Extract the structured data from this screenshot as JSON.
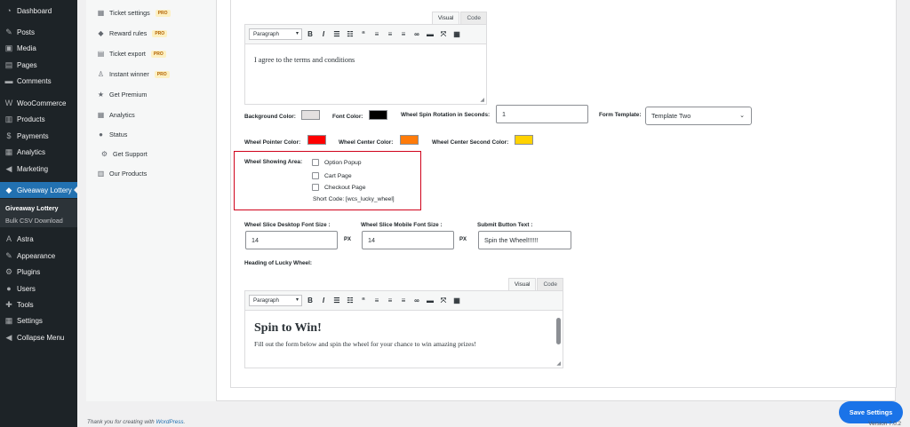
{
  "sidebar": {
    "items": [
      {
        "label": "Dashboard",
        "icon": "dashboard-icon",
        "glyph": "◔"
      },
      {
        "label": "Posts",
        "icon": "pin-icon",
        "glyph": "✎"
      },
      {
        "label": "Media",
        "icon": "media-icon",
        "glyph": "▣"
      },
      {
        "label": "Pages",
        "icon": "pages-icon",
        "glyph": "▤"
      },
      {
        "label": "Comments",
        "icon": "comments-icon",
        "glyph": "▬"
      },
      {
        "label": "WooCommerce",
        "icon": "woocommerce-icon",
        "glyph": "W"
      },
      {
        "label": "Products",
        "icon": "products-icon",
        "glyph": "▥"
      },
      {
        "label": "Payments",
        "icon": "payments-icon",
        "glyph": "$"
      },
      {
        "label": "Analytics",
        "icon": "analytics-icon",
        "glyph": "▦"
      },
      {
        "label": "Marketing",
        "icon": "marketing-icon",
        "glyph": "◀"
      },
      {
        "label": "Giveaway Lottery",
        "icon": "giveaway-icon",
        "glyph": "◆"
      },
      {
        "label": "Astra",
        "icon": "astra-icon",
        "glyph": "A"
      },
      {
        "label": "Appearance",
        "icon": "appearance-icon",
        "glyph": "✎"
      },
      {
        "label": "Plugins",
        "icon": "plugins-icon",
        "glyph": "⚙"
      },
      {
        "label": "Users",
        "icon": "users-icon",
        "glyph": "●"
      },
      {
        "label": "Tools",
        "icon": "tools-icon",
        "glyph": "✚"
      },
      {
        "label": "Settings",
        "icon": "settings-icon",
        "glyph": "▦"
      },
      {
        "label": "Collapse Menu",
        "icon": "collapse-icon",
        "glyph": "◀"
      }
    ],
    "submenu": [
      "Giveaway Lottery",
      "Bulk CSV Download"
    ]
  },
  "plugin_nav": {
    "items": [
      {
        "label": "Ticket settings",
        "pro": "PRO",
        "icon": "ticket-settings-icon",
        "glyph": "▦"
      },
      {
        "label": "Reward rules",
        "pro": "PRO",
        "icon": "reward-rules-icon",
        "glyph": "◆"
      },
      {
        "label": "Ticket export",
        "pro": "PRO",
        "icon": "ticket-export-icon",
        "glyph": "▤"
      },
      {
        "label": "Instant winner",
        "pro": "PRO",
        "icon": "instant-winner-icon",
        "glyph": "♙"
      },
      {
        "label": "Get Premium",
        "pro": "",
        "icon": "star-icon",
        "glyph": "★"
      },
      {
        "label": "Analytics",
        "pro": "",
        "icon": "analytics-icon",
        "glyph": "▦"
      },
      {
        "label": "Status",
        "pro": "",
        "icon": "status-icon",
        "glyph": "●"
      },
      {
        "label": "Get Support",
        "pro": "",
        "icon": "support-icon",
        "glyph": "⚙"
      },
      {
        "label": "Our Products",
        "pro": "",
        "icon": "products-icon",
        "glyph": "▥"
      }
    ]
  },
  "editor_terms": {
    "tab_visual": "Visual",
    "tab_code": "Code",
    "format": "Paragraph",
    "content": "I agree to the terms and conditions"
  },
  "fields": {
    "background_color_label": "Background Color:",
    "background_color": "#e3e0e0",
    "font_color_label": "Font Color:",
    "font_color": "#000000",
    "spin_rotation_label": "Wheel Spin Rotation in Seconds:",
    "spin_rotation_value": "1",
    "form_template_label": "Form Template:",
    "form_template_value": "Template Two",
    "pointer_color_label": "Wheel Pointer Color:",
    "pointer_color": "#ff0000",
    "center_color_label": "Wheel Center Color:",
    "center_color": "#ff7b0a",
    "center_second_color_label": "Wheel Center Second Color:",
    "center_second_color": "#ffd200",
    "showing_area_label": "Wheel Showing Area:",
    "option_popup": "Option Popup",
    "cart_page": "Cart Page",
    "checkout_page": "Checkout Page",
    "short_code": "Short Code: [wcs_lucky_wheel]",
    "desktop_font_label": "Wheel Slice Desktop Font Size :",
    "desktop_font_value": "14",
    "mobile_font_label": "Wheel Slice Mobile Font Size :",
    "mobile_font_value": "14",
    "px_unit": "PX",
    "submit_text_label": "Submit Button Text :",
    "submit_text_value": "Spin the Wheel!!!!!!",
    "heading_label": "Heading of Lucky Wheel:"
  },
  "editor_heading": {
    "tab_visual": "Visual",
    "tab_code": "Code",
    "format": "Paragraph",
    "heading": "Spin to Win!",
    "text": "Fill out the form below and spin the wheel for your chance to win amazing prizes!"
  },
  "save_label": "Save Settings",
  "footer": {
    "text": "Thank you for creating with",
    "link": "WordPress",
    "end": "."
  },
  "version": "Version 7.0.2"
}
